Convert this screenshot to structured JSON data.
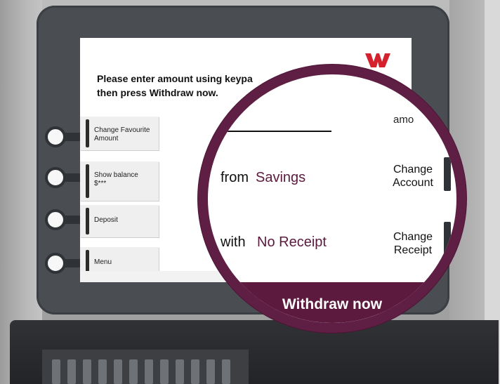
{
  "screen": {
    "instruction_line1": "Please enter amount using keypa",
    "instruction_line2": "then press Withdraw now.",
    "left_options": [
      {
        "label": "Change Favourite Amount"
      },
      {
        "label": "Show balance",
        "sub": "$***"
      },
      {
        "label": "Deposit"
      },
      {
        "label": "Menu"
      }
    ],
    "logo_icon": "westpac-w-logo",
    "colors": {
      "brand_red": "#d5202e",
      "accent_plum": "#5b1a3e"
    }
  },
  "magnifier": {
    "amount_partial": "amo",
    "from_label": "from",
    "from_value": "Savings",
    "with_label": "with",
    "with_value": "No Receipt",
    "change_account": "Change Account",
    "change_receipt": "Change Receipt",
    "withdraw_button": "Withdraw now"
  }
}
